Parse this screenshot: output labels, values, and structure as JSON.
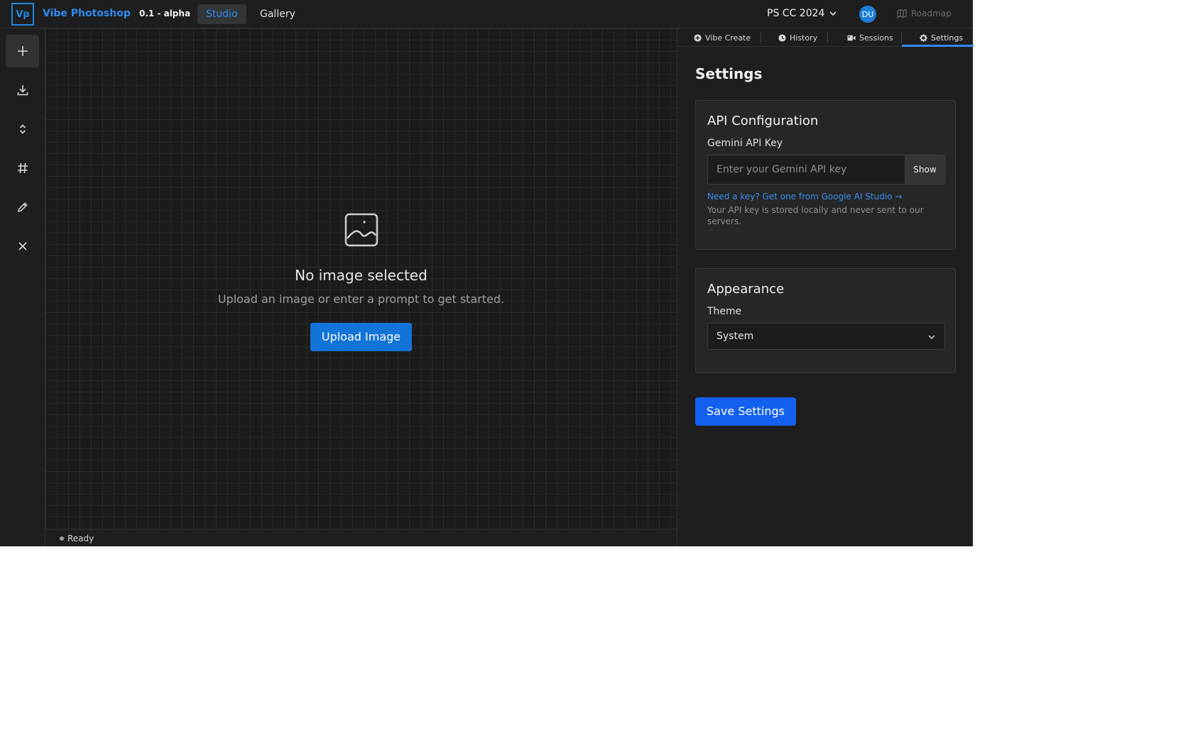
{
  "header": {
    "logo_text": "Vp",
    "app_name": "Vibe Photoshop",
    "version": "0.1 - alpha",
    "nav_tabs": [
      {
        "label": "Studio",
        "active": true
      },
      {
        "label": "Gallery",
        "active": false
      }
    ],
    "ps_version": "PS CC 2024",
    "avatar_initials": "DU",
    "roadmap_label": "Roadmap"
  },
  "toolbar": {
    "tools": [
      {
        "icon": "plus-icon",
        "active": true
      },
      {
        "icon": "download-icon",
        "active": false
      },
      {
        "icon": "chevrons-updown-icon",
        "active": false
      },
      {
        "icon": "hash-icon",
        "active": false
      },
      {
        "icon": "pencil-icon",
        "active": false
      },
      {
        "icon": "close-icon",
        "active": false
      }
    ]
  },
  "canvas": {
    "empty_title": "No image selected",
    "empty_subtitle": "Upload an image or enter a prompt to get started.",
    "upload_label": "Upload Image"
  },
  "status": {
    "text": "Ready"
  },
  "panel": {
    "tabs": [
      {
        "label": "Vibe Create",
        "icon": "plus-circle-icon"
      },
      {
        "label": "History",
        "icon": "clock-icon"
      },
      {
        "label": "Sessions",
        "icon": "video-icon"
      },
      {
        "label": "Settings",
        "icon": "gear-icon",
        "active": true
      }
    ],
    "title": "Settings",
    "api_card": {
      "title": "API Configuration",
      "key_label": "Gemini API Key",
      "key_placeholder": "Enter your Gemini API key",
      "key_value": "",
      "show_label": "Show",
      "link_text": "Need a key? Get one from Google AI Studio →",
      "note": "Your API key is stored locally and never sent to our servers."
    },
    "appearance_card": {
      "title": "Appearance",
      "theme_label": "Theme",
      "theme_value": "System"
    },
    "save_label": "Save Settings"
  },
  "colors": {
    "accent": "#2f8bf0",
    "upload_button": "#1273d8",
    "save_button": "#1360f0",
    "background": "#1f1f1f"
  }
}
